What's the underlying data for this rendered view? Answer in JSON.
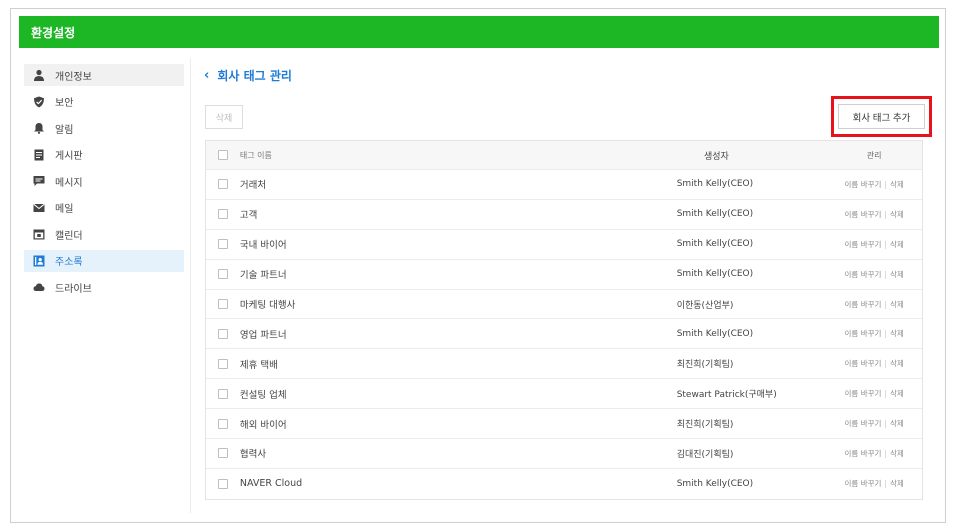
{
  "app": {
    "title": "환경설정"
  },
  "sidebar": {
    "items": [
      {
        "label": "개인정보",
        "icon": "person-icon"
      },
      {
        "label": "보안",
        "icon": "shield-icon"
      },
      {
        "label": "알림",
        "icon": "bell-icon"
      },
      {
        "label": "게시판",
        "icon": "board-icon"
      },
      {
        "label": "메시지",
        "icon": "message-icon"
      },
      {
        "label": "메일",
        "icon": "mail-icon"
      },
      {
        "label": "캘린더",
        "icon": "calendar-icon"
      },
      {
        "label": "주소록",
        "icon": "contacts-icon"
      },
      {
        "label": "드라이브",
        "icon": "cloud-icon"
      }
    ],
    "selected_index": 7
  },
  "main": {
    "title": "회사 태그 관리",
    "delete_label": "삭제",
    "add_label": "회사 태그 추가",
    "table": {
      "headers": {
        "name": "태그 이름",
        "creator": "생성자",
        "manage": "관리"
      },
      "rename_label": "이름 바꾸기",
      "delete_label": "삭제",
      "rows": [
        {
          "name": "거래처",
          "creator": "Smith Kelly(CEO)"
        },
        {
          "name": "고객",
          "creator": "Smith Kelly(CEO)"
        },
        {
          "name": "국내 바이어",
          "creator": "Smith Kelly(CEO)"
        },
        {
          "name": "기술 파트너",
          "creator": "Smith Kelly(CEO)"
        },
        {
          "name": "마케팅 대행사",
          "creator": "이한동(산업부)"
        },
        {
          "name": "영업 파트너",
          "creator": "Smith Kelly(CEO)"
        },
        {
          "name": "제휴 택배",
          "creator": "최진희(기획팀)"
        },
        {
          "name": "컨설팅 업체",
          "creator": "Stewart Patrick(구매부)"
        },
        {
          "name": "해외 바이어",
          "creator": "최진희(기획팀)"
        },
        {
          "name": "협력사",
          "creator": "김대진(기획팀)"
        },
        {
          "name": "NAVER Cloud",
          "creator": "Smith Kelly(CEO)"
        }
      ]
    }
  },
  "colors": {
    "header_green": "#1db726",
    "accent_blue": "#1e7bd6",
    "highlight_red": "#e8121b"
  }
}
